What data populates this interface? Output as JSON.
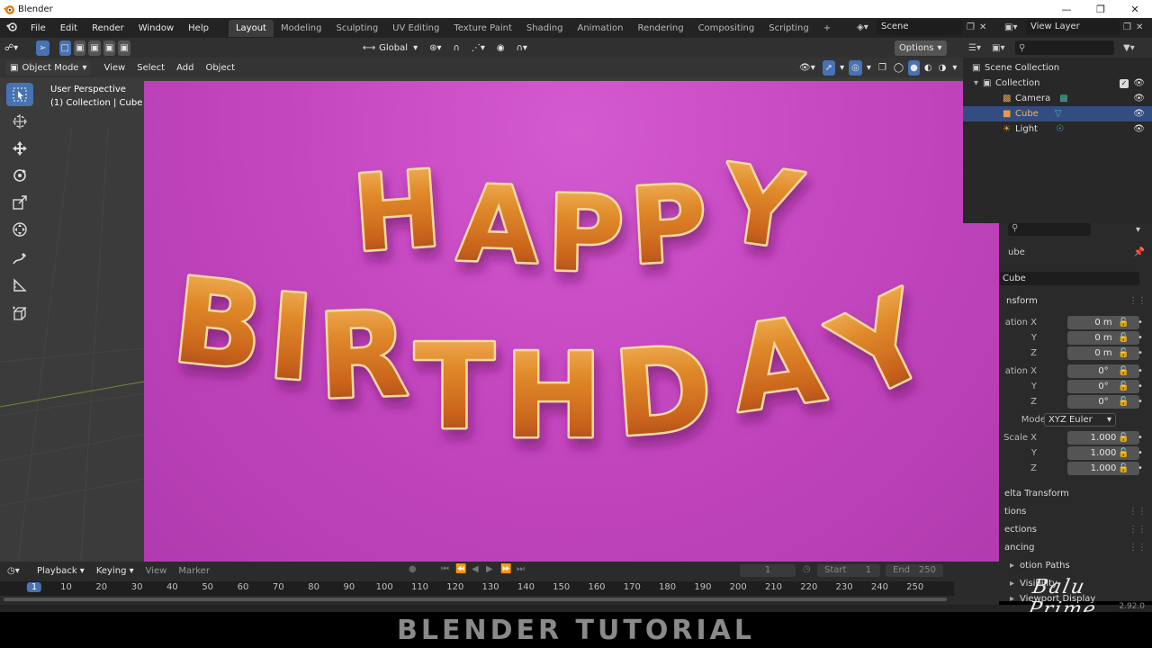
{
  "window": {
    "title": "Blender"
  },
  "menu": [
    "File",
    "Edit",
    "Render",
    "Window",
    "Help"
  ],
  "workspaces": [
    "Layout",
    "Modeling",
    "Sculpting",
    "UV Editing",
    "Texture Paint",
    "Shading",
    "Animation",
    "Rendering",
    "Compositing",
    "Scripting"
  ],
  "active_workspace": "Layout",
  "scene": {
    "name": "Scene",
    "view_layer": "View Layer"
  },
  "viewport": {
    "transform_orientation": "Global",
    "options_label": "Options",
    "mode": "Object Mode",
    "header_menus": [
      "View",
      "Select",
      "Add",
      "Object"
    ],
    "overlay_title": "User Perspective",
    "overlay_sub": "(1) Collection | Cube"
  },
  "render_text": {
    "line1": [
      "H",
      "A",
      "P",
      "P",
      "Y"
    ],
    "line2": [
      "B",
      "I",
      "R",
      "T",
      "H",
      "D",
      "A",
      "Y"
    ]
  },
  "outliner": {
    "root": "Scene Collection",
    "collection": "Collection",
    "items": [
      {
        "name": "Camera",
        "selected": false
      },
      {
        "name": "Cube",
        "selected": true
      },
      {
        "name": "Light",
        "selected": false
      }
    ]
  },
  "properties": {
    "object_name_header": "ube",
    "object_name_field": "Cube",
    "section": "nsform",
    "location": {
      "label_x": "ation X",
      "y": "Y",
      "z": "Z",
      "vals": [
        "0 m",
        "0 m",
        "0 m"
      ]
    },
    "rotation": {
      "label_x": "ation X",
      "y": "Y",
      "z": "Z",
      "vals": [
        "0°",
        "0°",
        "0°"
      ]
    },
    "mode": {
      "label": "Mode",
      "value": "XYZ Euler"
    },
    "scale": {
      "label_x": "Scale X",
      "y": "Y",
      "z": "Z",
      "vals": [
        "1.000",
        "1.000",
        "1.000"
      ]
    },
    "collapsed": [
      "elta Transform",
      "tions",
      "ections",
      "ancing",
      "otion Paths",
      "Visibility",
      "Viewport Display"
    ]
  },
  "timeline": {
    "menus": [
      "Playback",
      "Keying",
      "View",
      "Marker"
    ],
    "current_frame": "1",
    "start_label": "Start",
    "start": "1",
    "end_label": "End",
    "end": "250",
    "ticks": [
      "1",
      "10",
      "20",
      "30",
      "40",
      "50",
      "60",
      "70",
      "80",
      "90",
      "100",
      "110",
      "120",
      "130",
      "140",
      "150",
      "160",
      "170",
      "180",
      "190",
      "200",
      "210",
      "220",
      "230",
      "240",
      "250"
    ]
  },
  "status": {
    "version": "2.92.0"
  },
  "overlay_caption": "BLENDER TUTORIAL",
  "watermark": "Balu Prime",
  "colors": {
    "accent": "#4772b3",
    "balloon": "#e08a2a",
    "backdrop": "#c447c0"
  }
}
